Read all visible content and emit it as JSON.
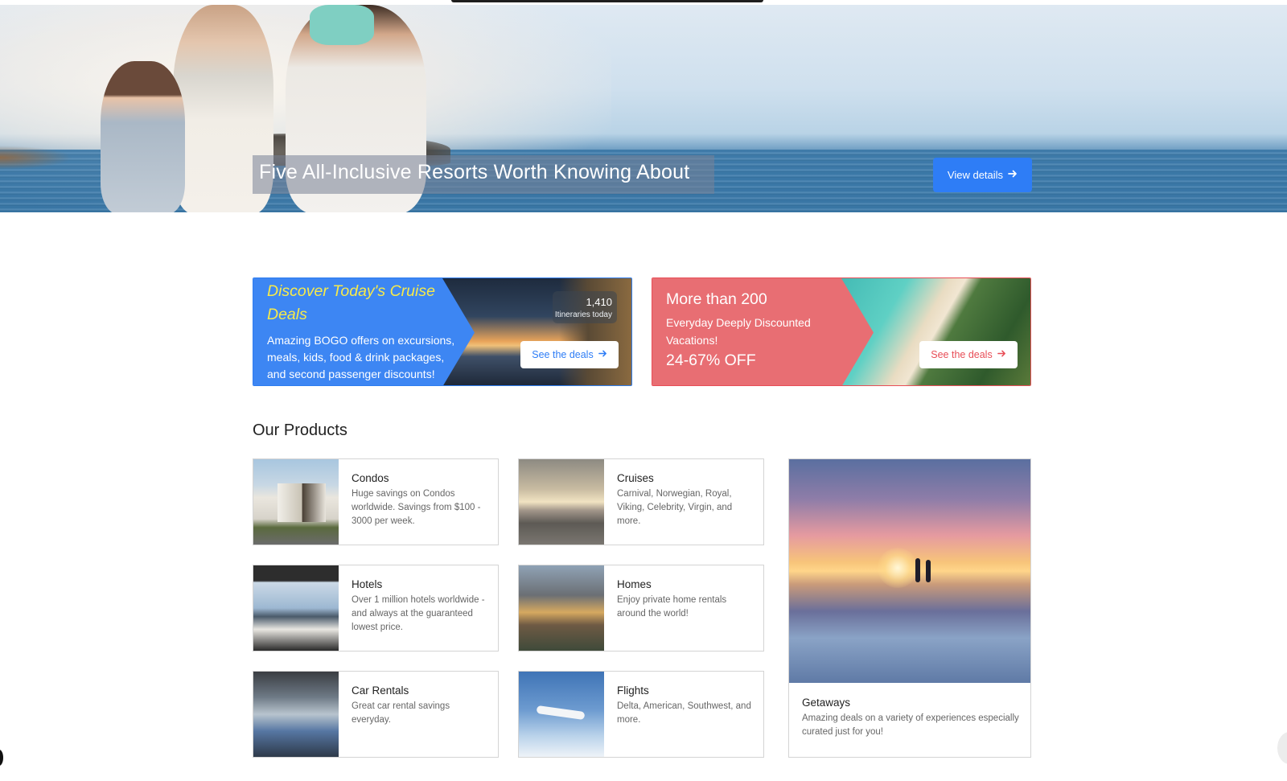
{
  "hero": {
    "title": "Five All-Inclusive Resorts Worth Knowing About",
    "button_label": "View details",
    "button_icon": "arrow-right-icon"
  },
  "promos": {
    "cruise": {
      "title": "Discover Today's Cruise Deals",
      "description": "Amazing BOGO offers on excursions, meals, kids, food & drink packages, and second passenger discounts!",
      "badge_count": "1,410",
      "badge_label": "Itineraries today",
      "button_label": "See the deals",
      "accent_color": "#2f7df0",
      "title_color": "#f7ea4a"
    },
    "vacations": {
      "line1": "More than 200",
      "line2": "Everyday Deeply Discounted Vacations!",
      "line3": "24-67% OFF",
      "button_label": "See the deals",
      "accent_color": "#e86e73"
    }
  },
  "products": {
    "section_title": "Our Products",
    "items": [
      {
        "name": "Condos",
        "description": "Huge savings on Condos worldwide. Savings from $100 - 3000 per week."
      },
      {
        "name": "Cruises",
        "description": "Carnival, Norwegian, Royal, Viking, Celebrity, Virgin, and more."
      },
      {
        "name": "Hotels",
        "description": "Over 1 million hotels worldwide - and always at the guaranteed lowest price."
      },
      {
        "name": "Homes",
        "description": "Enjoy private home rentals around the world!"
      },
      {
        "name": "Car Rentals",
        "description": "Great car rental savings everyday."
      },
      {
        "name": "Flights",
        "description": "Delta, American, Southwest, and more."
      }
    ],
    "featured": {
      "name": "Getaways",
      "description": "Amazing deals on a variety of experiences especially curated just for you!"
    }
  },
  "colors": {
    "primary_button": "#2e7df6",
    "deals_red": "#e84e57"
  }
}
